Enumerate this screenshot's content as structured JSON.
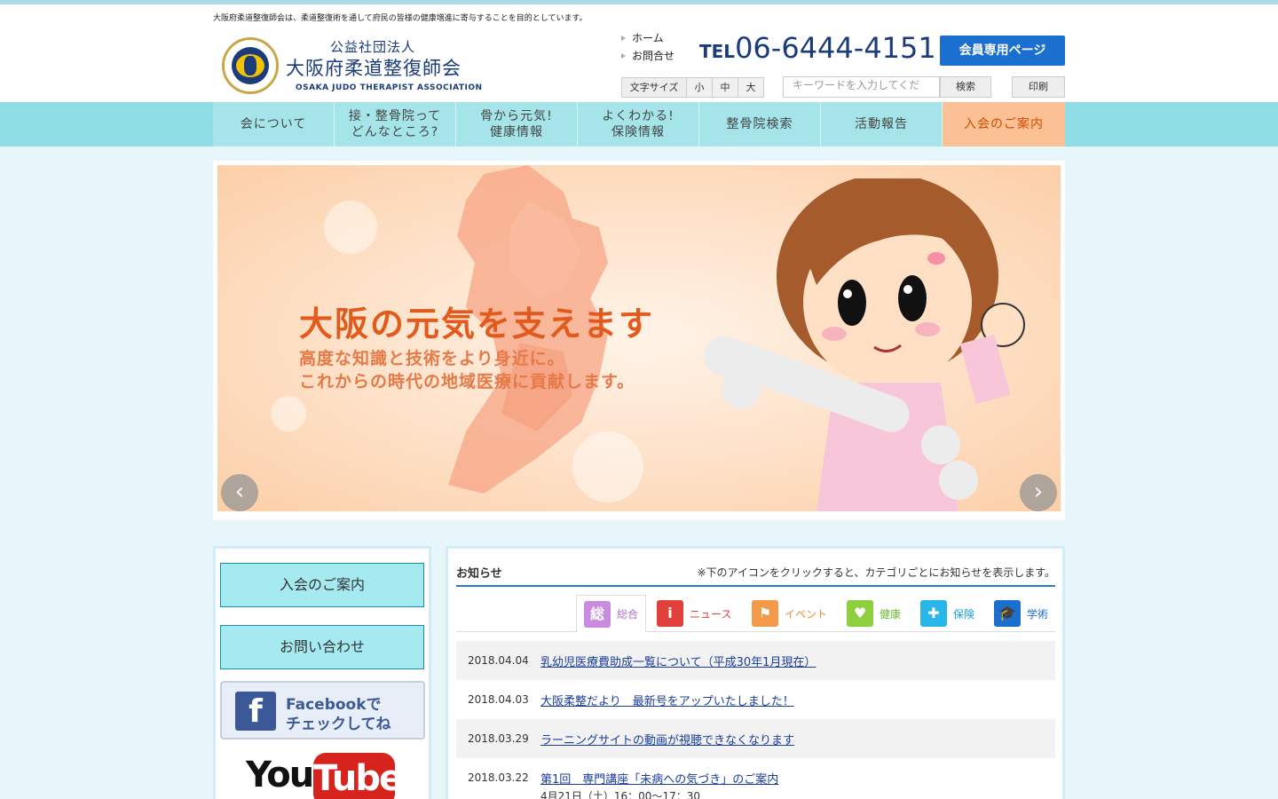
{
  "header": {
    "tagline": "大阪府柔道整復師会は、柔道整復術を通して府民の皆様の健康増進に寄与することを目的としています。",
    "logo_sub": "公益社団法人",
    "logo_main": "大阪府柔道整復師会",
    "logo_en": "OSAKA JUDO THERAPIST ASSOCIATION",
    "links": [
      "ホーム",
      "お問合せ"
    ],
    "tel_label": "TEL",
    "tel_number": "06-6444-4151",
    "member_button": "会員専用ページ",
    "font_size_label": "文字サイズ",
    "font_sizes": [
      "小",
      "中",
      "大"
    ],
    "search_placeholder": "キーワードを入力してくだ",
    "search_button": "検索",
    "print_button": "印刷"
  },
  "nav": [
    {
      "line1": "会について",
      "line2": ""
    },
    {
      "line1": "接・整骨院って",
      "line2": "どんなところ?"
    },
    {
      "line1": "骨から元気!",
      "line2": "健康情報"
    },
    {
      "line1": "よくわかる!",
      "line2": "保険情報"
    },
    {
      "line1": "整骨院検索",
      "line2": ""
    },
    {
      "line1": "活動報告",
      "line2": ""
    },
    {
      "line1": "入会のご案内",
      "line2": ""
    }
  ],
  "slider": {
    "title": "大阪の元気を支えます",
    "line1": "高度な知識と技術をより身近に。",
    "line2": "これからの時代の地域医療に貢献します。",
    "prev": "‹",
    "next": "›"
  },
  "sidebar": {
    "join_button": "入会のご案内",
    "contact_button": "お問い合わせ",
    "facebook_line1": "Facebookで",
    "facebook_line2": "チェックしてね",
    "youtube_you": "You",
    "youtube_tube": "Tube"
  },
  "news": {
    "title": "お知らせ",
    "note": "※下のアイコンをクリックすると、カテゴリごとにお知らせを表示します。",
    "categories": [
      {
        "label": "総合",
        "glyph": "総",
        "color": "#c98be0",
        "text_color": "#b06fd0"
      },
      {
        "label": "ニュース",
        "glyph": "i",
        "color": "#e2403b",
        "text_color": "#e2403b"
      },
      {
        "label": "イベント",
        "glyph": "⚑",
        "color": "#f39a4a",
        "text_color": "#f08a30"
      },
      {
        "label": "健康",
        "glyph": "♥",
        "color": "#8dcf3f",
        "text_color": "#6ab82c"
      },
      {
        "label": "保険",
        "glyph": "✚",
        "color": "#29b6e8",
        "text_color": "#1aa2d8"
      },
      {
        "label": "学術",
        "glyph": "🎓",
        "color": "#1b6fcf",
        "text_color": "#1b6fcf"
      }
    ],
    "items": [
      {
        "date": "2018.04.04",
        "title": "乳幼児医療費助成一覧について（平成30年1月現在）"
      },
      {
        "date": "2018.04.03",
        "title": "大阪柔整だより　最新号をアップいたしました！"
      },
      {
        "date": "2018.03.29",
        "title": "ラーニングサイトの動画が視聴できなくなります"
      },
      {
        "date": "2018.03.22",
        "title": "第1回　専門講座「未病への気づき」のご案内"
      }
    ],
    "item4_sub": "4月21日（土）16：00～17：30"
  }
}
